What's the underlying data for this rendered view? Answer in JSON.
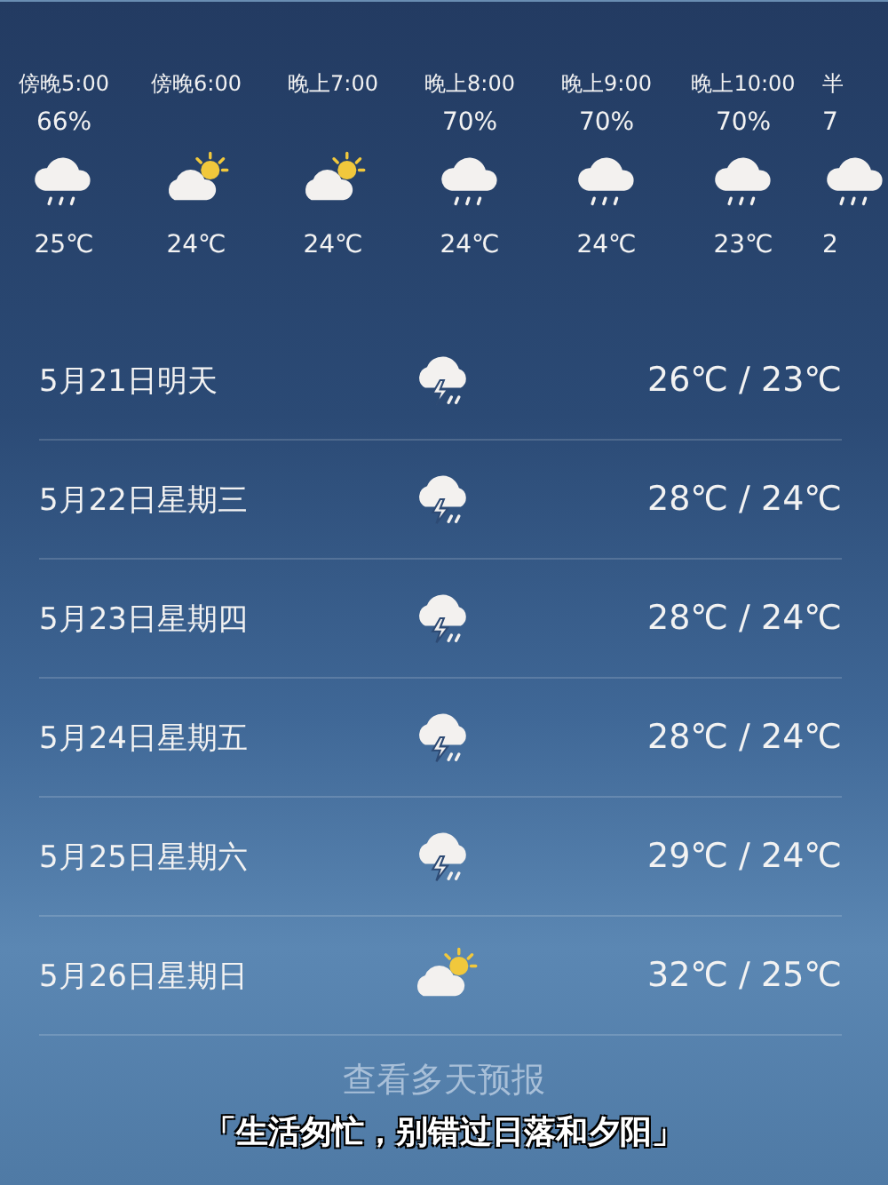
{
  "hourly": [
    {
      "time": "傍晚5:00",
      "precip": "66%",
      "kind": "rain",
      "temp": "25℃"
    },
    {
      "time": "傍晚6:00",
      "kind": "suncloud",
      "temp": "24℃"
    },
    {
      "time": "晚上7:00",
      "kind": "suncloud",
      "temp": "24℃"
    },
    {
      "time": "晚上8:00",
      "precip": "70%",
      "kind": "rain",
      "temp": "24℃"
    },
    {
      "time": "晚上9:00",
      "precip": "70%",
      "kind": "rain",
      "temp": "24℃"
    },
    {
      "time": "晚上10:00",
      "precip": "70%",
      "kind": "rain",
      "temp": "23℃"
    },
    {
      "time": "半",
      "precip": "7",
      "kind": "rain",
      "temp": "2"
    }
  ],
  "daily": [
    {
      "date": "5月21日明天",
      "kind": "thunder",
      "temps": "26℃ / 23℃"
    },
    {
      "date": "5月22日星期三",
      "kind": "thunder",
      "temps": "28℃ / 24℃"
    },
    {
      "date": "5月23日星期四",
      "kind": "thunder",
      "temps": "28℃ / 24℃"
    },
    {
      "date": "5月24日星期五",
      "kind": "thunder",
      "temps": "28℃ / 24℃"
    },
    {
      "date": "5月25日星期六",
      "kind": "thunder",
      "temps": "29℃ / 24℃"
    },
    {
      "date": "5月26日星期日",
      "kind": "suncloud",
      "temps": "32℃ / 25℃"
    }
  ],
  "more_link": "查看多天预报",
  "caption": "「生活匆忙，别错过日落和夕阳」"
}
